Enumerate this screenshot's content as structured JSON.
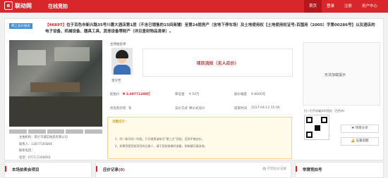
{
  "header": {
    "logo_mark": "e",
    "logo_text": "联动网",
    "site_name": "在线竞拍",
    "nav": [
      "首页",
      "登录",
      "注册",
      "用户中心"
    ]
  },
  "auction": {
    "tag": "网上竞价拍卖",
    "lot": "【46897】",
    "title": "位于百色市新兴路35号川惠大酒店第1层（不含已销售的15间商铺）至第24层房产（含地下停车场）及土地使用权【土地使用权证号:百国用（2005）字第00286号】以及酒店的电子设备、机械设备、器具工具、其他设备等财产（详见查封物品清单）。",
    "host_label": "主持拍卖师",
    "host_name": "李宁芳",
    "status": "项目流拍（无人应价）",
    "no_remind": "无法加载提示",
    "start_price_label": "起拍价",
    "start_price": "¥ 3.09771200亿",
    "deposit_label": "保证金",
    "deposit": "¥ 10万",
    "increment_label": "加价幅度",
    "increment": "¥ 8000元",
    "priority_label": "优先购买权",
    "priority": "有",
    "method_label": "竞价方式",
    "method": "降价式竞价",
    "end_label": "结束时间",
    "end_time": "2017-04-13 15:00",
    "warn_title": "温馨提示：",
    "warn_lines": [
      "1、同一账号同一时段，只可使用该账号“第三方”竞拍，否则不能应价。",
      "2、如果您是竞拍项目的注册人，请于竞拍前做好准备，如有疑问请咨询。"
    ],
    "contact": [
      "主拍机构：南宁市诚信拍卖有限公司",
      "联系人：13677165806",
      "联系电话：",
      "电话：0771-5346693",
      "拍卖师：李宁芳（1103367）"
    ],
    "qr_label": "扫一扫手机端实时竞拍（百色市）",
    "share_label": "项目分享",
    "follow_label": "设置提醒"
  },
  "bottom": {
    "section1": "本场拍卖会项目",
    "section2": "应价记录",
    "section2_count": "(0)",
    "print_label": "打印",
    "record_label": "应价记录",
    "section3": "举牌竞拍号"
  }
}
